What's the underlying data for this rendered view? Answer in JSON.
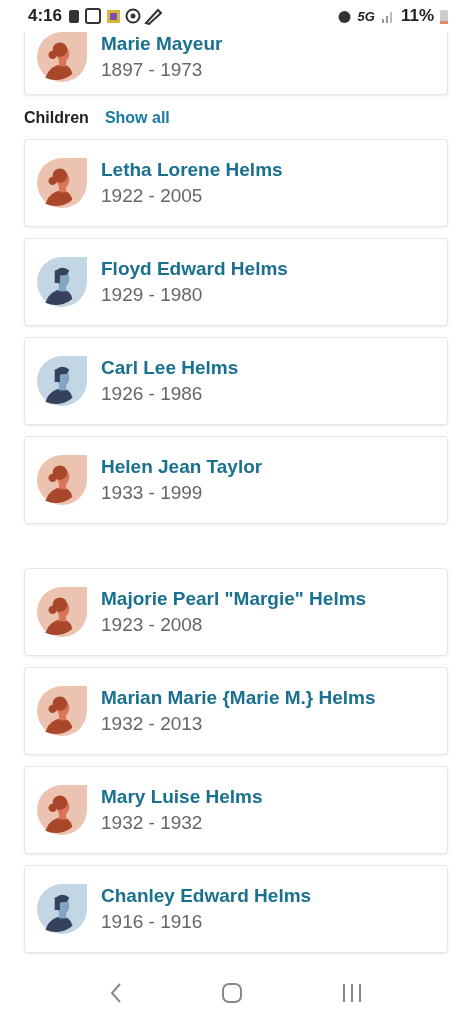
{
  "status_bar": {
    "time": "4:16",
    "network": "5G",
    "battery": "11%"
  },
  "parent_card": {
    "name": "Marie Mayeur",
    "years": "1897 - 1973",
    "kind": "female"
  },
  "children_section": {
    "title": "Children",
    "action": "Show all",
    "people": [
      {
        "name": "Letha Lorene Helms",
        "years": "1922 - 2005",
        "kind": "female"
      },
      {
        "name": "Floyd Edward Helms",
        "years": "1929 - 1980",
        "kind": "male"
      },
      {
        "name": "Carl Lee Helms",
        "years": "1926 - 1986",
        "kind": "male"
      },
      {
        "name": "Helen Jean Taylor",
        "years": "1933 - 1999",
        "kind": "female"
      }
    ]
  },
  "more_people": [
    {
      "name": "Majorie Pearl \"Margie\" Helms",
      "years": "1923 - 2008",
      "kind": "female"
    },
    {
      "name": "Marian Marie {Marie M.} Helms",
      "years": "1932 - 2013",
      "kind": "female"
    },
    {
      "name": "Mary Luise Helms",
      "years": "1932 - 1932",
      "kind": "female"
    },
    {
      "name": "Chanley Edward Helms",
      "years": "1916 - 1916",
      "kind": "male"
    }
  ]
}
